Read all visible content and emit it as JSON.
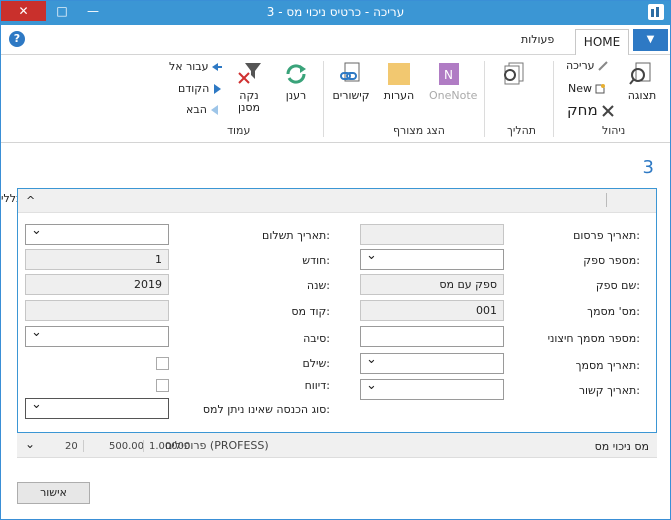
{
  "window": {
    "title": "עריכה - כרטיס ניכוי מס - 3",
    "close_glyph": "✕",
    "max_glyph": "□",
    "min_glyph": "—"
  },
  "tabs": {
    "help_glyph": "?",
    "actions": "פעולות",
    "home": "HOME",
    "file_glyph": "▼"
  },
  "ribbon": {
    "manage": {
      "label": "ניהול",
      "view": "תצוגה",
      "edit": "עריכה",
      "new": "New",
      "delete": "מחק"
    },
    "process": {
      "label": "תהליך"
    },
    "show_attached": {
      "label": "הצג מצורף",
      "onenote": "OneNote",
      "notes": "הערות",
      "links": "קישורים",
      "paperclips": "הערות"
    },
    "page": {
      "label": "עמוד",
      "refresh": "רענן",
      "clear_filter": "נקה מסנן",
      "goto": "עבור אל",
      "previous": "הקודם",
      "next": "הבא"
    }
  },
  "page_title": "3",
  "section": {
    "clipped_label": "כללי",
    "chevron": "^"
  },
  "fields": {
    "publish_date": {
      "label": "תאריך פרסום:",
      "value": ""
    },
    "vendor_no": {
      "label": "מספר ספק:",
      "value": ""
    },
    "vendor_name": {
      "label": "שם ספק:",
      "value": "ספק עם מס"
    },
    "tax_doc_no": {
      "label": "מס' מסמך:",
      "value": "001"
    },
    "ext_doc_no": {
      "label": "מספר מסמך חיצוני:",
      "value": ""
    },
    "doc_date": {
      "label": "תאריך מסמך:",
      "value": ""
    },
    "link_date": {
      "label": "תאריך קשור:",
      "value": ""
    },
    "payment_date": {
      "label": "תאריך תשלום:",
      "value": ""
    },
    "month": {
      "label": "חודש:",
      "value": "1"
    },
    "year": {
      "label": "שנה:",
      "value": "2019"
    },
    "tax_code": {
      "label": "קוד מס:",
      "value": ""
    },
    "reason": {
      "label": "סיבה:",
      "value": ""
    },
    "paid": {
      "label": "שילם:"
    },
    "reported": {
      "label": "דיווח:"
    },
    "income_type": {
      "label": "סוג הכנסה שאינו ניתן למס:",
      "value": ""
    }
  },
  "fasttab": {
    "title": "מס ניכוי מס",
    "profile": "פרופילים (PROFESS)",
    "v1": "1.00000",
    "v2": "500.00",
    "v3": "20"
  },
  "ok_button": "אישור"
}
